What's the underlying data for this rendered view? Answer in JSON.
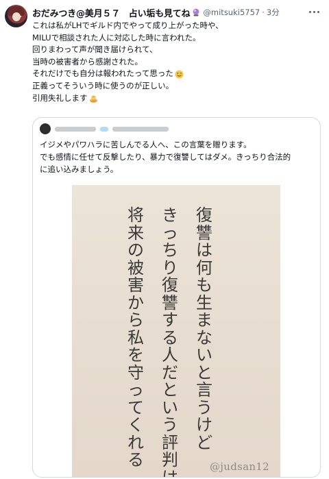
{
  "post": {
    "display_name": "おだみつき@美月５７　占い垢も見てね",
    "handle": "@mitsuki5757",
    "separator": "·",
    "time": "3分",
    "text_lines": [
      "これは私がLHでギルド内でやって成り上がった時や、",
      "MILUで相談された人に対応した時に言われた。",
      "回りまわって声が聞き届けられて、",
      "当時の被害者から感謝された。",
      "それだけでも自分は報われたって思った",
      "正義ってそういう時に使うのが正しい。",
      "引用失礼します"
    ],
    "emojis": [
      "crystal-ball",
      "smiling-face",
      "bowing-person"
    ]
  },
  "quoted": {
    "text_lines": [
      "イジメやパワハラに苦しんでる人へ、この言葉を贈ります。",
      "でも感情に任せて反撃したり、暴力で復讐してはダメ。きっちり合法的",
      "に追い込みましょう。"
    ],
    "image": {
      "columns": [
        "復讐は何も生まないと言うけど",
        "きっちり復讐する人だという評判は",
        "将来の被害から私を守ってくれる"
      ],
      "watermark": "@judsan12"
    }
  },
  "colors": {
    "text": "#0f1419",
    "muted": "#536471",
    "border": "#cfd9de",
    "card_paper": "#e8dfd3",
    "card_ink": "#3b3a38"
  }
}
